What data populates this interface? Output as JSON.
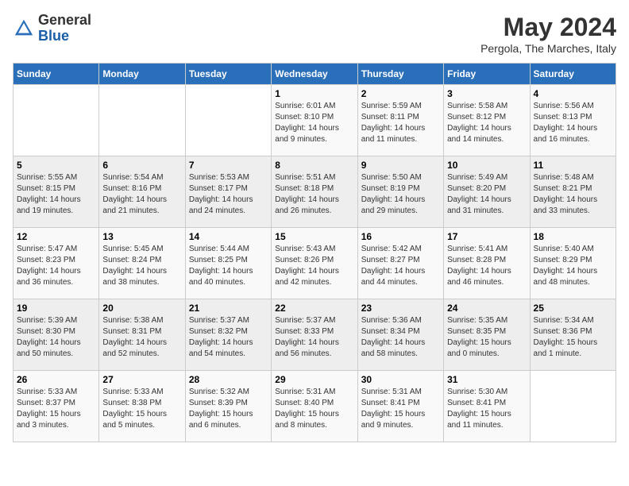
{
  "header": {
    "logo_general": "General",
    "logo_blue": "Blue",
    "month": "May 2024",
    "location": "Pergola, The Marches, Italy"
  },
  "days_of_week": [
    "Sunday",
    "Monday",
    "Tuesday",
    "Wednesday",
    "Thursday",
    "Friday",
    "Saturday"
  ],
  "weeks": [
    [
      {
        "day": "",
        "info": ""
      },
      {
        "day": "",
        "info": ""
      },
      {
        "day": "",
        "info": ""
      },
      {
        "day": "1",
        "info": "Sunrise: 6:01 AM\nSunset: 8:10 PM\nDaylight: 14 hours and 9 minutes."
      },
      {
        "day": "2",
        "info": "Sunrise: 5:59 AM\nSunset: 8:11 PM\nDaylight: 14 hours and 11 minutes."
      },
      {
        "day": "3",
        "info": "Sunrise: 5:58 AM\nSunset: 8:12 PM\nDaylight: 14 hours and 14 minutes."
      },
      {
        "day": "4",
        "info": "Sunrise: 5:56 AM\nSunset: 8:13 PM\nDaylight: 14 hours and 16 minutes."
      }
    ],
    [
      {
        "day": "5",
        "info": "Sunrise: 5:55 AM\nSunset: 8:15 PM\nDaylight: 14 hours and 19 minutes."
      },
      {
        "day": "6",
        "info": "Sunrise: 5:54 AM\nSunset: 8:16 PM\nDaylight: 14 hours and 21 minutes."
      },
      {
        "day": "7",
        "info": "Sunrise: 5:53 AM\nSunset: 8:17 PM\nDaylight: 14 hours and 24 minutes."
      },
      {
        "day": "8",
        "info": "Sunrise: 5:51 AM\nSunset: 8:18 PM\nDaylight: 14 hours and 26 minutes."
      },
      {
        "day": "9",
        "info": "Sunrise: 5:50 AM\nSunset: 8:19 PM\nDaylight: 14 hours and 29 minutes."
      },
      {
        "day": "10",
        "info": "Sunrise: 5:49 AM\nSunset: 8:20 PM\nDaylight: 14 hours and 31 minutes."
      },
      {
        "day": "11",
        "info": "Sunrise: 5:48 AM\nSunset: 8:21 PM\nDaylight: 14 hours and 33 minutes."
      }
    ],
    [
      {
        "day": "12",
        "info": "Sunrise: 5:47 AM\nSunset: 8:23 PM\nDaylight: 14 hours and 36 minutes."
      },
      {
        "day": "13",
        "info": "Sunrise: 5:45 AM\nSunset: 8:24 PM\nDaylight: 14 hours and 38 minutes."
      },
      {
        "day": "14",
        "info": "Sunrise: 5:44 AM\nSunset: 8:25 PM\nDaylight: 14 hours and 40 minutes."
      },
      {
        "day": "15",
        "info": "Sunrise: 5:43 AM\nSunset: 8:26 PM\nDaylight: 14 hours and 42 minutes."
      },
      {
        "day": "16",
        "info": "Sunrise: 5:42 AM\nSunset: 8:27 PM\nDaylight: 14 hours and 44 minutes."
      },
      {
        "day": "17",
        "info": "Sunrise: 5:41 AM\nSunset: 8:28 PM\nDaylight: 14 hours and 46 minutes."
      },
      {
        "day": "18",
        "info": "Sunrise: 5:40 AM\nSunset: 8:29 PM\nDaylight: 14 hours and 48 minutes."
      }
    ],
    [
      {
        "day": "19",
        "info": "Sunrise: 5:39 AM\nSunset: 8:30 PM\nDaylight: 14 hours and 50 minutes."
      },
      {
        "day": "20",
        "info": "Sunrise: 5:38 AM\nSunset: 8:31 PM\nDaylight: 14 hours and 52 minutes."
      },
      {
        "day": "21",
        "info": "Sunrise: 5:37 AM\nSunset: 8:32 PM\nDaylight: 14 hours and 54 minutes."
      },
      {
        "day": "22",
        "info": "Sunrise: 5:37 AM\nSunset: 8:33 PM\nDaylight: 14 hours and 56 minutes."
      },
      {
        "day": "23",
        "info": "Sunrise: 5:36 AM\nSunset: 8:34 PM\nDaylight: 14 hours and 58 minutes."
      },
      {
        "day": "24",
        "info": "Sunrise: 5:35 AM\nSunset: 8:35 PM\nDaylight: 15 hours and 0 minutes."
      },
      {
        "day": "25",
        "info": "Sunrise: 5:34 AM\nSunset: 8:36 PM\nDaylight: 15 hours and 1 minute."
      }
    ],
    [
      {
        "day": "26",
        "info": "Sunrise: 5:33 AM\nSunset: 8:37 PM\nDaylight: 15 hours and 3 minutes."
      },
      {
        "day": "27",
        "info": "Sunrise: 5:33 AM\nSunset: 8:38 PM\nDaylight: 15 hours and 5 minutes."
      },
      {
        "day": "28",
        "info": "Sunrise: 5:32 AM\nSunset: 8:39 PM\nDaylight: 15 hours and 6 minutes."
      },
      {
        "day": "29",
        "info": "Sunrise: 5:31 AM\nSunset: 8:40 PM\nDaylight: 15 hours and 8 minutes."
      },
      {
        "day": "30",
        "info": "Sunrise: 5:31 AM\nSunset: 8:41 PM\nDaylight: 15 hours and 9 minutes."
      },
      {
        "day": "31",
        "info": "Sunrise: 5:30 AM\nSunset: 8:41 PM\nDaylight: 15 hours and 11 minutes."
      },
      {
        "day": "",
        "info": ""
      }
    ]
  ]
}
